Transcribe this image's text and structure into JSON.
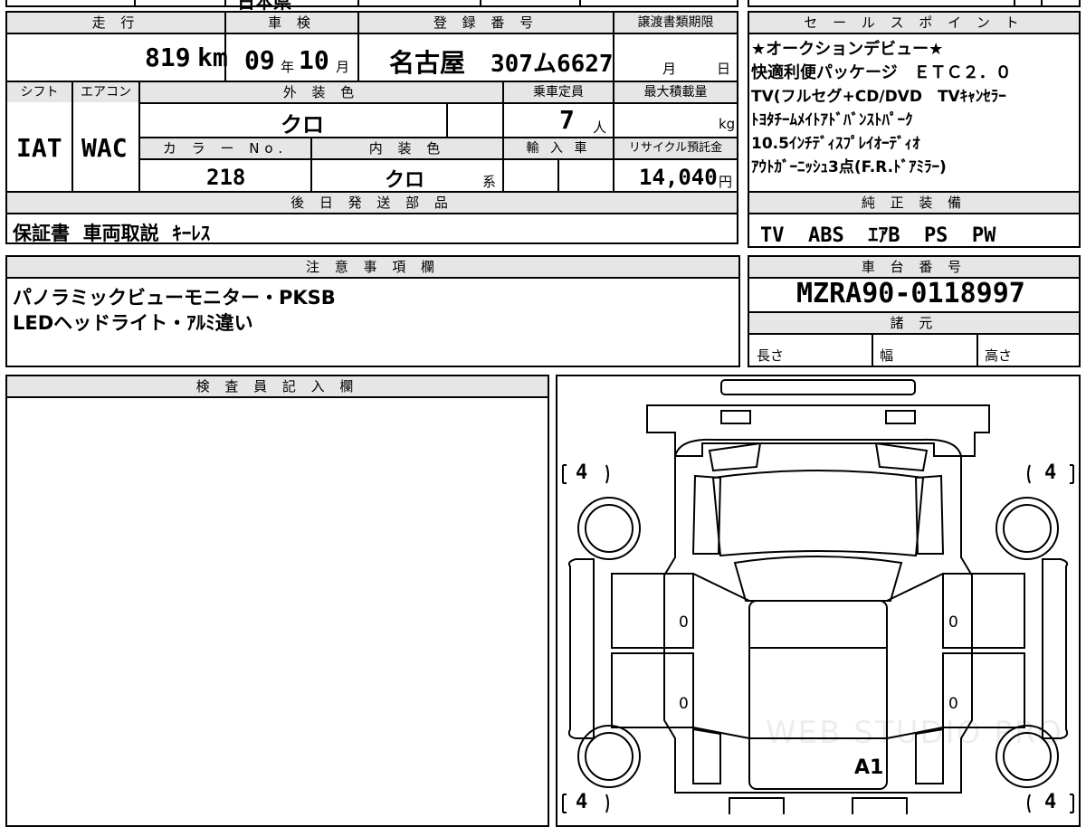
{
  "top_strip": {
    "partial_text": "日本県"
  },
  "mileage": {
    "label": "走 行",
    "value": "819",
    "unit": "km"
  },
  "inspection": {
    "label": "車 検",
    "year": "09",
    "year_unit": "年",
    "month": "10",
    "month_unit": "月"
  },
  "registration": {
    "label": "登 録 番 号",
    "region": "名古屋",
    "number": "307ム6627"
  },
  "transfer_deadline": {
    "label": "譲渡書類期限",
    "month_unit": "月",
    "day_unit": "日"
  },
  "shift": {
    "label": "シフト",
    "value": "IAT"
  },
  "aircon": {
    "label": "エアコン",
    "value": "WAC"
  },
  "exterior_color": {
    "label": "外 装 色",
    "value": "クロ"
  },
  "capacity": {
    "label": "乗車定員",
    "value": "7",
    "unit": "人"
  },
  "max_load": {
    "label": "最大積載量",
    "unit": "kg"
  },
  "color_no": {
    "label": "カ ラ ー No.",
    "value": "218"
  },
  "interior_color": {
    "label": "内 装 色",
    "value": "クロ",
    "suffix": "系"
  },
  "import_car": {
    "label": "輸 入 車"
  },
  "recycle_fee": {
    "label": "リサイクル預託金",
    "value": "14,040",
    "unit": "円"
  },
  "later_parts": {
    "label": "後 日 発 送 部 品",
    "value": "保証書  車両取説  ｷｰﾚｽ"
  },
  "sales_points": {
    "label": "セ ー ル ス ポ イ ン ト",
    "lines": [
      "★オークションデビュー★",
      "快適利便パッケージ　ＥＴＣ２．０",
      "TV(フルセグ+CD/DVD　TVｷｬﾝｾﾗｰ",
      "ﾄﾖﾀﾁｰﾑﾒｲﾄｱﾄﾞﾊﾞﾝｽﾄﾊﾟｰｸ",
      "10.5ｲﾝﾁﾃﾞｨｽﾌﾟﾚｲｵｰﾃﾞｨｵ",
      "ｱｳﾄｶﾞｰﾆｯｼｭ3点(F.R.ﾄﾞｱﾐﾗｰ)"
    ]
  },
  "standard_equipment": {
    "label": "純 正 装 備",
    "value": "TV  ABS  ｴｱB  PS  PW"
  },
  "notes": {
    "label": "注 意 事 項 欄",
    "lines": [
      "パノラミックビューモニター・PKSB",
      "LEDヘッドライト・ｱﾙﾐ違い"
    ]
  },
  "chassis": {
    "label": "車 台 番 号",
    "value": "MZRA90-0118997"
  },
  "specs": {
    "label": "諸 元",
    "length_label": "長さ",
    "width_label": "幅",
    "height_label": "高さ"
  },
  "inspector": {
    "label": "検 査 員 記 入 欄"
  },
  "diagram": {
    "tire_front_left": "4",
    "tire_front_right": "4",
    "tire_rear_left": "4",
    "tire_rear_right": "4",
    "door_front_left": "0",
    "door_rear_left": "0",
    "door_front_right": "0",
    "door_rear_right": "0",
    "damage_mark": "A1",
    "watermark": "WEB STUDIO PRO"
  }
}
